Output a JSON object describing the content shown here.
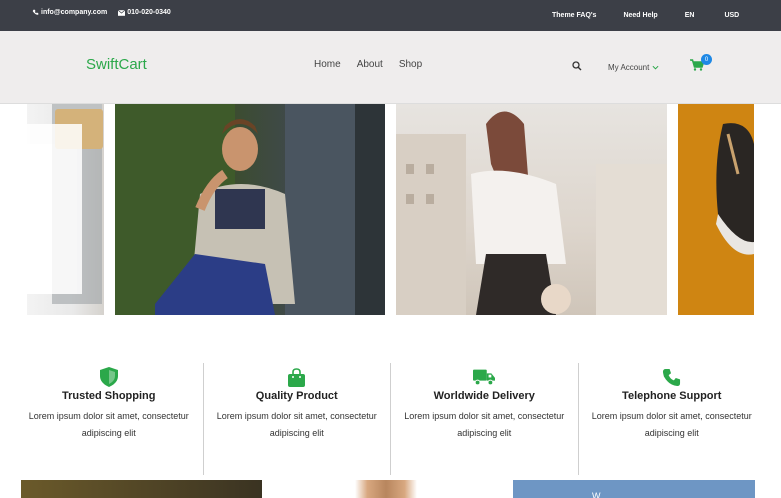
{
  "topbar": {
    "email": "info@company.com",
    "phone": "010-020-0340",
    "faq": "Theme FAQ's",
    "help": "Need Help",
    "language": "EN",
    "currency": "USD"
  },
  "header": {
    "brand": "SwiftCart",
    "nav": [
      "Home",
      "About",
      "Shop"
    ],
    "account": "My Account",
    "cart_count": "0"
  },
  "features": [
    {
      "icon": "shield-icon",
      "title": "Trusted Shopping",
      "desc": "Lorem ipsum dolor sit amet, consectetur adipiscing elit"
    },
    {
      "icon": "shopping-bag-icon",
      "title": "Quality Product",
      "desc": "Lorem ipsum dolor sit amet, consectetur adipiscing elit"
    },
    {
      "icon": "truck-icon",
      "title": "Worldwide Delivery",
      "desc": "Lorem ipsum dolor sit amet, consectetur adipiscing elit"
    },
    {
      "icon": "phone-icon",
      "title": "Telephone Support",
      "desc": "Lorem ipsum dolor sit amet, consectetur adipiscing elit"
    }
  ],
  "promo": {
    "partial_text": "W"
  },
  "colors": {
    "accent": "#2ba84a",
    "topbar": "#3c3f47",
    "header": "#efeded",
    "badge": "#1e88e5"
  }
}
